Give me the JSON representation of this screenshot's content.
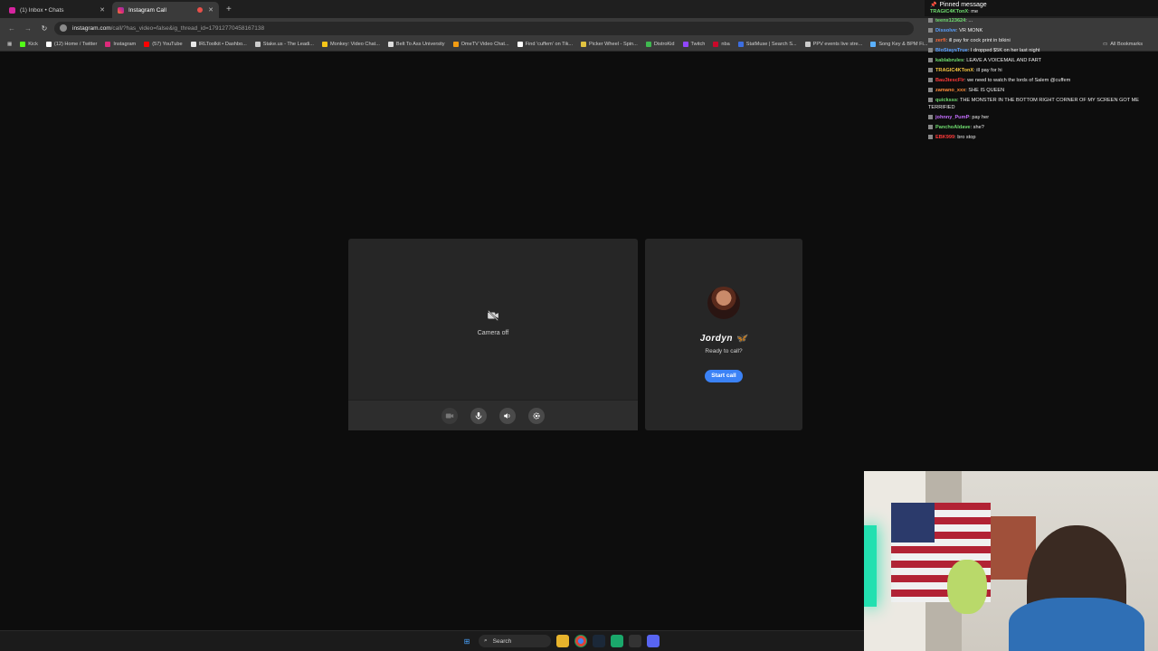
{
  "browser": {
    "tabs": [
      {
        "title": "(1) Inbox • Chats",
        "active": false
      },
      {
        "title": "Instagram Call",
        "active": true
      }
    ],
    "new_tab": "+",
    "url_host": "instagram.com",
    "url_path": "/call/?has_video=false&ig_thread_id=17912770458167138",
    "bookmarks": [
      {
        "label": "Kick",
        "color": "#53fc18"
      },
      {
        "label": "(12) Home / Twitter",
        "color": "#ffffff"
      },
      {
        "label": "Instagram",
        "color": "#dd2a7b"
      },
      {
        "label": "(57) YouTube",
        "color": "#ff0000"
      },
      {
        "label": "IRLToolkit • Dashbo...",
        "color": "#e8e8e8"
      },
      {
        "label": "Stake.us - The Leadi...",
        "color": "#cccccc"
      },
      {
        "label": "Monkey: Video Chat...",
        "color": "#f5c518"
      },
      {
        "label": "Belt To Ass University",
        "color": "#dddddd"
      },
      {
        "label": "OmeTV Video Chat...",
        "color": "#f39c12"
      },
      {
        "label": "Find 'cuffem' on Tik...",
        "color": "#ffffff"
      },
      {
        "label": "Picker Wheel - Spin...",
        "color": "#e1c340"
      },
      {
        "label": "DistroKid",
        "color": "#3fb950"
      },
      {
        "label": "Twitch",
        "color": "#9146ff"
      },
      {
        "label": "nba",
        "color": "#c9082a"
      },
      {
        "label": "StatMuse | Search S...",
        "color": "#3c6ee0"
      },
      {
        "label": "PPV events live stre...",
        "color": "#cccccc"
      },
      {
        "label": "Song Key & BPM Fi...",
        "color": "#5ab0ff"
      }
    ],
    "all_bookmarks": "All Bookmarks"
  },
  "call": {
    "camera_off": "Camera off",
    "peer_name": "Jordyn 🦋",
    "peer_status": "Ready to call?",
    "start_call": "Start call"
  },
  "chat": {
    "pinned_header": "Pinned message",
    "pinned_user": "TRAGIC4KTonX",
    "pinned_text": ": me",
    "messages": [
      {
        "user": "teenx123624",
        "color": "#6fdc6f",
        "text": ": ..."
      },
      {
        "user": "Dissolve",
        "color": "#5aa0ff",
        "text": ": VR MONK"
      },
      {
        "user": "zerfi",
        "color": "#ff6a3a",
        "text": ": ill pay for cock print in bikini"
      },
      {
        "user": "BloStaysTrue",
        "color": "#5aa0ff",
        "text": ": I dropped $5K on her last night"
      },
      {
        "user": "kablabrules",
        "color": "#6fdc6f",
        "text": ": LEAVE A VOICEMAIL AND FART"
      },
      {
        "user": "TRAGIC4KTonX",
        "color": "#f5c542",
        "text": ": ill pay for hi"
      },
      {
        "user": "Bau3tescFlr",
        "color": "#ff3a3a",
        "text": ": we need to watch the lords of Salem @cuffem"
      },
      {
        "user": "zamano_xxx",
        "color": "#ff8c3a",
        "text": ": SHE IS QUEEN"
      },
      {
        "user": "quicksss",
        "color": "#6fdc6f",
        "text": ": THE MONSTER IN THE BOTTOM RIGHT CORNER OF MY SCREEN GOT ME TERRIFIED"
      },
      {
        "user": "johnny_PumP",
        "color": "#c66fff",
        "text": ": pay her"
      },
      {
        "user": "PanchoAldave",
        "color": "#6fdc6f",
        "text": ": she?"
      },
      {
        "user": "EBK999",
        "color": "#ff3a3a",
        "text": ": bro stop"
      }
    ]
  },
  "taskbar": {
    "search": "Search"
  }
}
